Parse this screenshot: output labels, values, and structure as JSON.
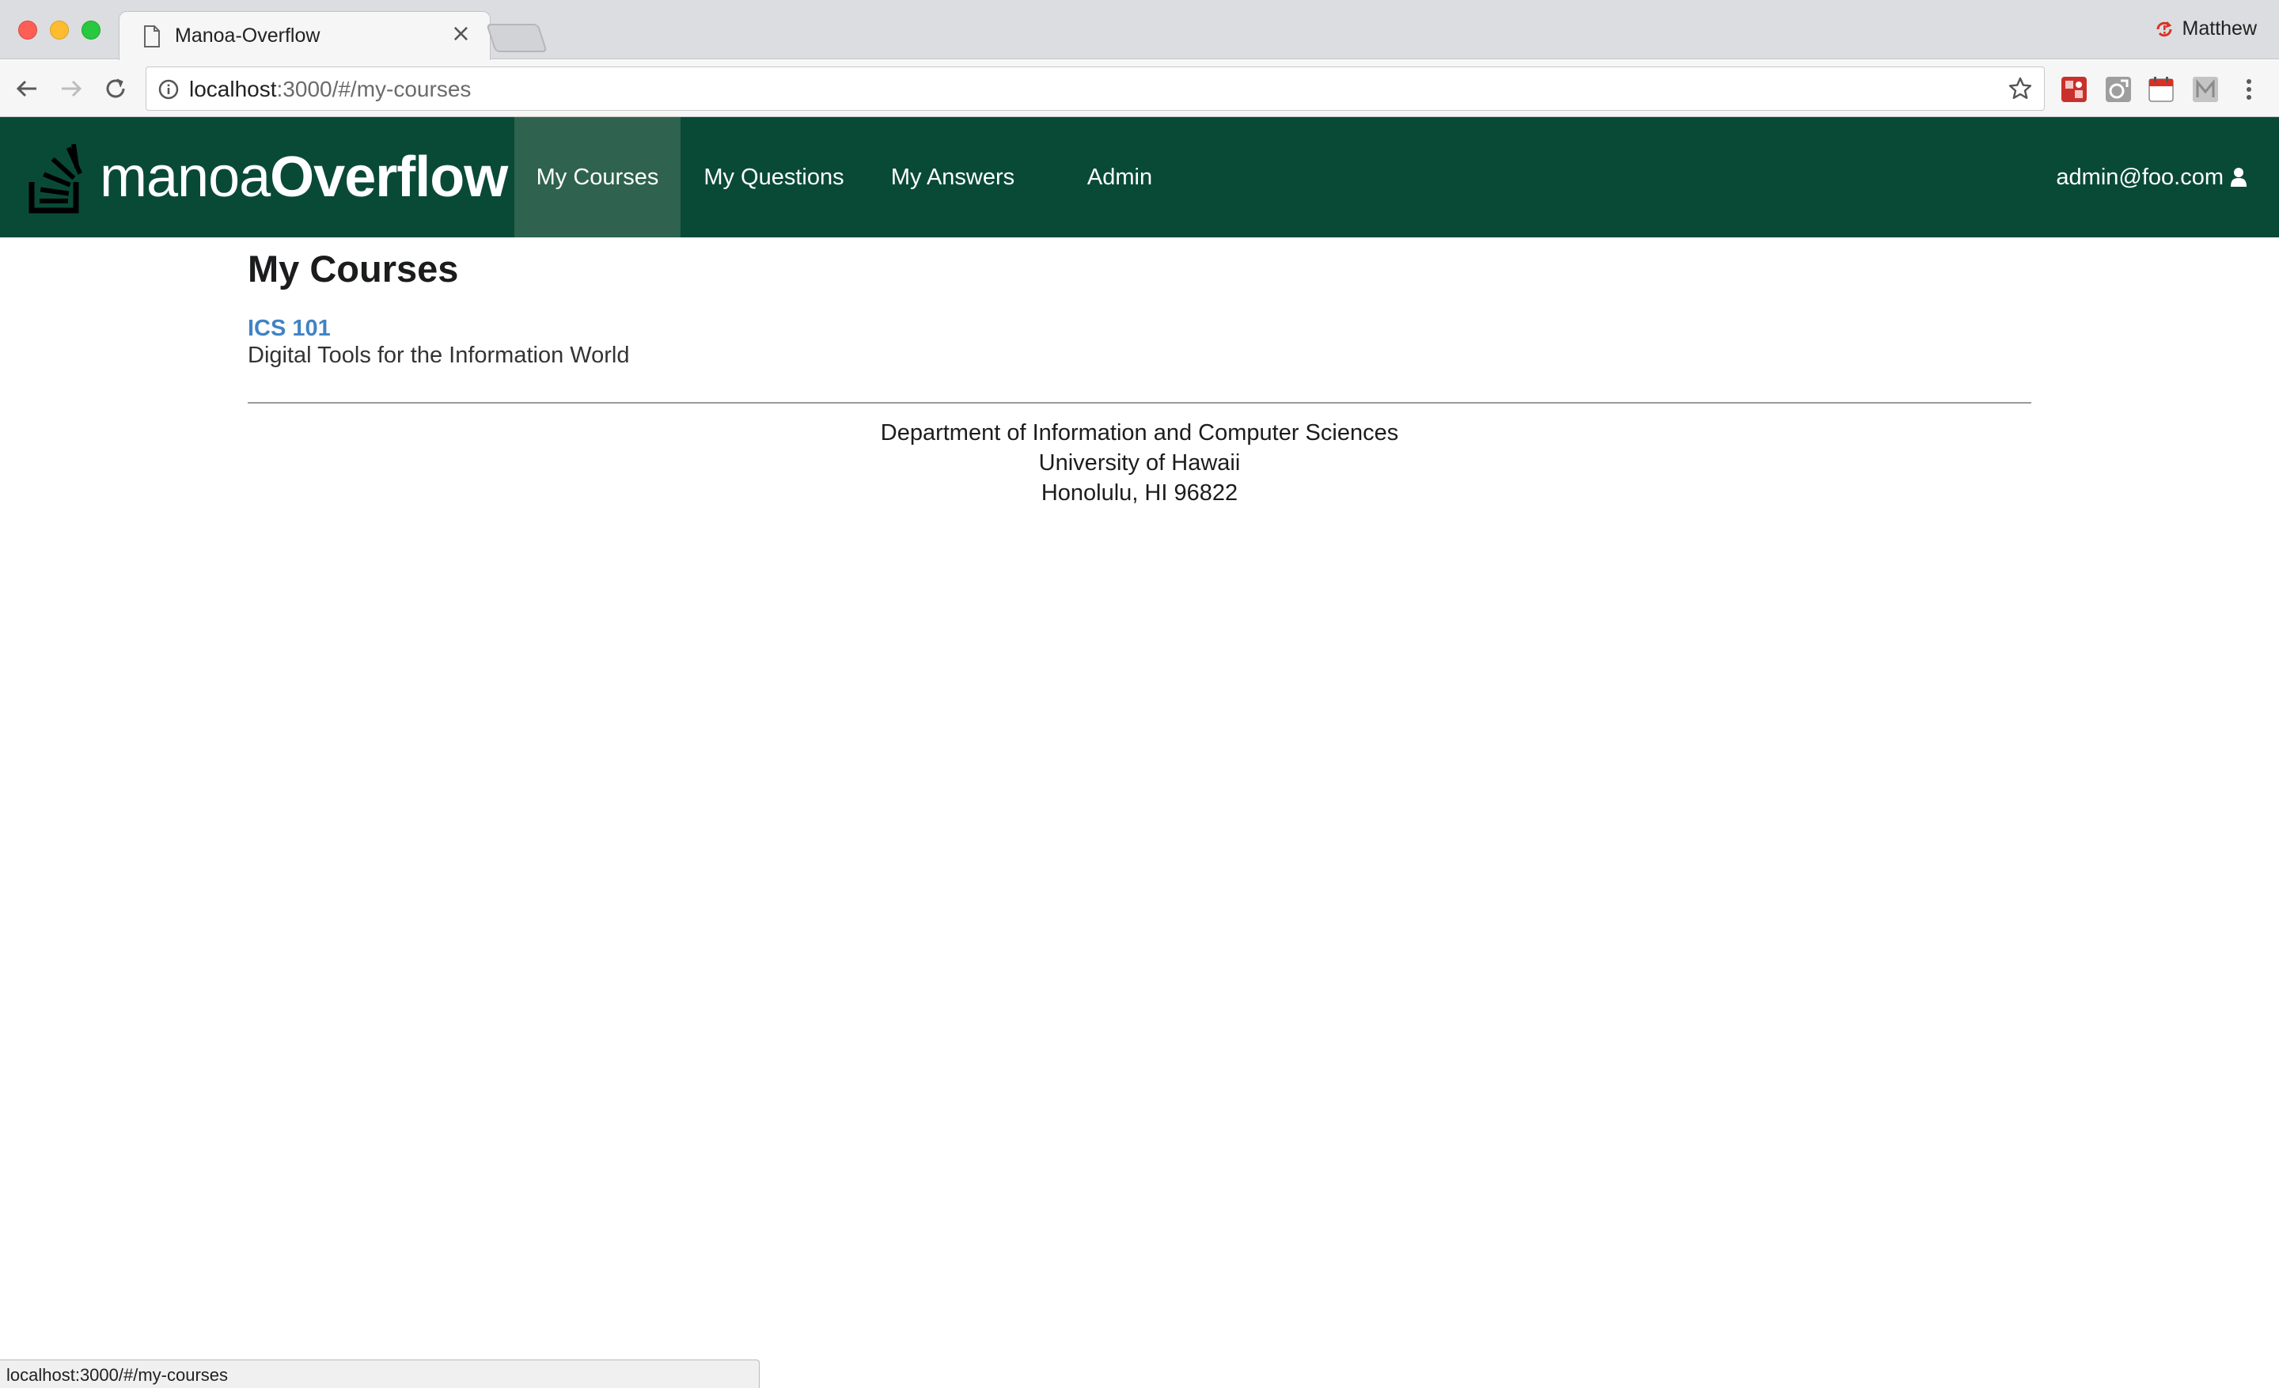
{
  "browser": {
    "tab_title": "Manoa-Overflow",
    "tab_close": "×",
    "profile_name": "Matthew",
    "url_host": "localhost",
    "url_rest": ":3000/#/my-courses",
    "status_url": "localhost:3000/#/my-courses"
  },
  "nav": {
    "brand_light": "manoa",
    "brand_bold": "Overflow",
    "items": [
      {
        "label": "My Courses",
        "active": true
      },
      {
        "label": "My Questions",
        "active": false
      },
      {
        "label": "My Answers",
        "active": false
      },
      {
        "label": "Admin",
        "active": false
      }
    ],
    "user_email": "admin@foo.com",
    "colors": {
      "bar": "#094a37",
      "active": "#2f634f"
    }
  },
  "main": {
    "title": "My Courses",
    "courses": [
      {
        "code": "ICS 101",
        "name": "Digital Tools for the Information World"
      }
    ]
  },
  "footer": {
    "line1": "Department of Information and Computer Sciences",
    "line2": "University of Hawaii",
    "line3": "Honolulu, HI 96822"
  },
  "colors": {
    "link": "#4183c4"
  }
}
